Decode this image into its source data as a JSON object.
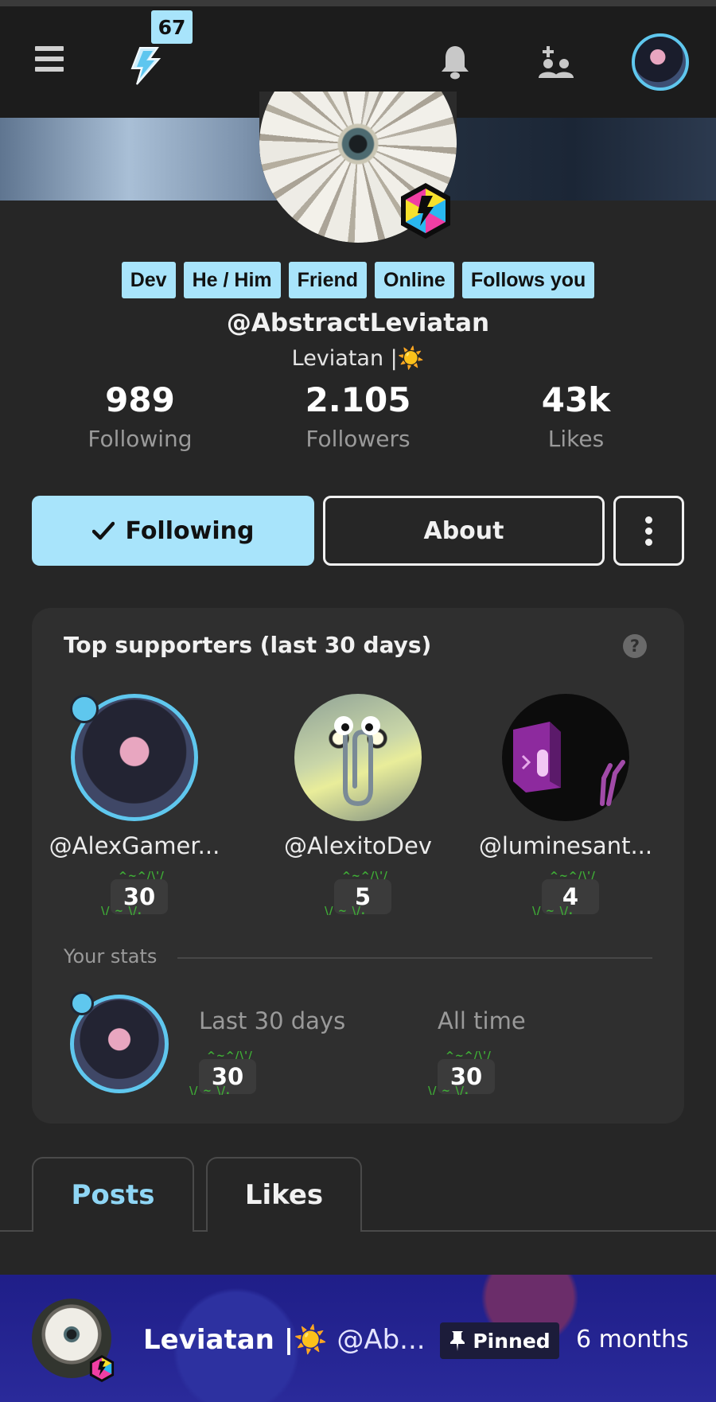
{
  "header": {
    "notification_count": "67",
    "icons": [
      "hamburger-menu-icon",
      "lightning-bolt-icon",
      "bell-icon",
      "add-user-icon"
    ]
  },
  "profile": {
    "tags": [
      "Dev",
      "He / Him",
      "Friend",
      "Online",
      "Follows you"
    ],
    "handle": "@AbstractLeviatan",
    "display_name": "Leviatan |☀️",
    "stats": [
      {
        "value": "989",
        "label": "Following"
      },
      {
        "value": "2.105",
        "label": "Followers"
      },
      {
        "value": "43k",
        "label": "Likes"
      }
    ],
    "buttons": {
      "following": "Following",
      "about": "About"
    }
  },
  "supporters": {
    "title": "Top supporters (last 30 days)",
    "help": "?",
    "list": [
      {
        "name": "@AlexGamer...",
        "count": "30"
      },
      {
        "name": "@AlexitoDev",
        "count": "5"
      },
      {
        "name": "@luminesant...",
        "count": "4"
      }
    ],
    "your_stats": {
      "label": "Your stats",
      "last30_label": "Last 30 days",
      "last30_value": "30",
      "alltime_label": "All time",
      "alltime_value": "30"
    }
  },
  "tabs": [
    {
      "label": "Posts",
      "active": true
    },
    {
      "label": "Likes",
      "active": false
    }
  ],
  "post": {
    "author_name": "Leviatan |",
    "author_sun": "☀️",
    "author_handle": "@Ab...",
    "pinned_label": "Pinned",
    "time": "6 months"
  },
  "colors": {
    "accent": "#a8e4fb",
    "background": "#262626",
    "card": "#2f2f2f",
    "header": "#1c1c1c",
    "streak_green": "#3fae36"
  }
}
